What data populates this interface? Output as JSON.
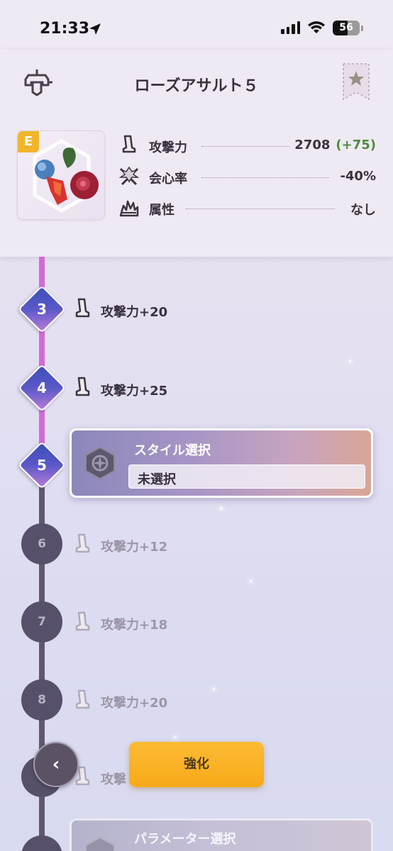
{
  "status_bar": {
    "time": "21:33",
    "battery": "56",
    "battery_level": 0.56
  },
  "header": {
    "title": "ローズアサルト５"
  },
  "item": {
    "rank": "E",
    "stats": [
      {
        "label": "攻撃力",
        "value": "2708",
        "bonus": "(+75)",
        "icon": "sword-icon"
      },
      {
        "label": "会心率",
        "value": "-40%",
        "bonus": "",
        "icon": "crossed-swords-icon"
      },
      {
        "label": "属性",
        "value": "なし",
        "bonus": "",
        "icon": "element-flame-icon"
      }
    ]
  },
  "timeline": {
    "nodes": [
      {
        "number": "3",
        "label": "攻撃力+20",
        "state": "unlocked"
      },
      {
        "number": "4",
        "label": "攻撃力+25",
        "state": "unlocked"
      },
      {
        "number": "5",
        "label": "スタイル選択",
        "state": "current"
      },
      {
        "number": "6",
        "label": "攻撃力+12",
        "state": "locked"
      },
      {
        "number": "7",
        "label": "攻撃力+18",
        "state": "locked"
      },
      {
        "number": "8",
        "label": "攻撃力+20",
        "state": "locked"
      },
      {
        "number": "",
        "label": "攻撃",
        "state": "locked"
      }
    ],
    "style_card": {
      "title": "スタイル選択",
      "value": "未選択"
    },
    "param_card": {
      "title": "パラメーター選択"
    }
  },
  "controls": {
    "back_label": "‹",
    "enhance_label": "強化"
  },
  "colors": {
    "accent_pink": "#d46ad8",
    "enhance_orange": "#fdbb35",
    "bonus_green": "#4d8a3f"
  }
}
